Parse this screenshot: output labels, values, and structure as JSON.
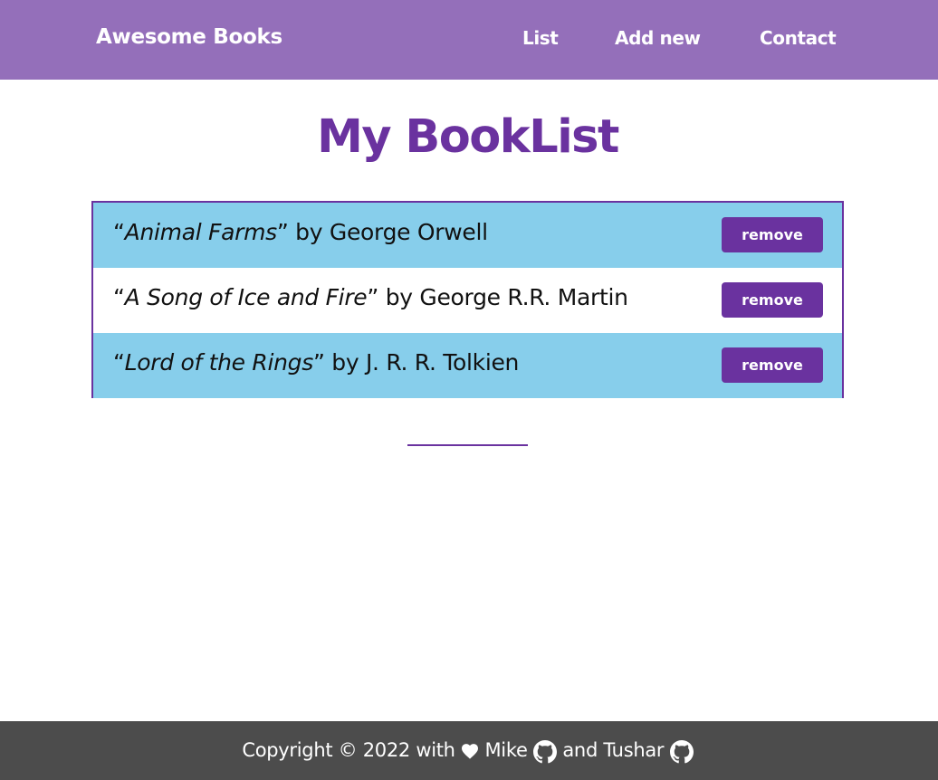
{
  "nav": {
    "brand": "Awesome Books",
    "links": [
      "List",
      "Add new",
      "Contact"
    ]
  },
  "main": {
    "title": "My BookList",
    "books": [
      {
        "title": "Animal Farms",
        "author": "George Orwell"
      },
      {
        "title": "A Song of Ice and Fire",
        "author": "George R.R. Martin"
      },
      {
        "title": "Lord of the Rings",
        "author": "J. R. R. Tolkien"
      }
    ],
    "remove_label": "remove",
    "open_quote": "“",
    "close_by": "” by "
  },
  "footer": {
    "prefix": "Copyright © 2022 with",
    "name1": "Mike",
    "joiner": "and Tushar"
  },
  "colors": {
    "navbar": "#946fba",
    "accent": "#6a329f",
    "row_highlight": "#87ceeb",
    "footer": "#4c4c4c"
  },
  "icons": [
    "heart-icon",
    "github-icon"
  ]
}
